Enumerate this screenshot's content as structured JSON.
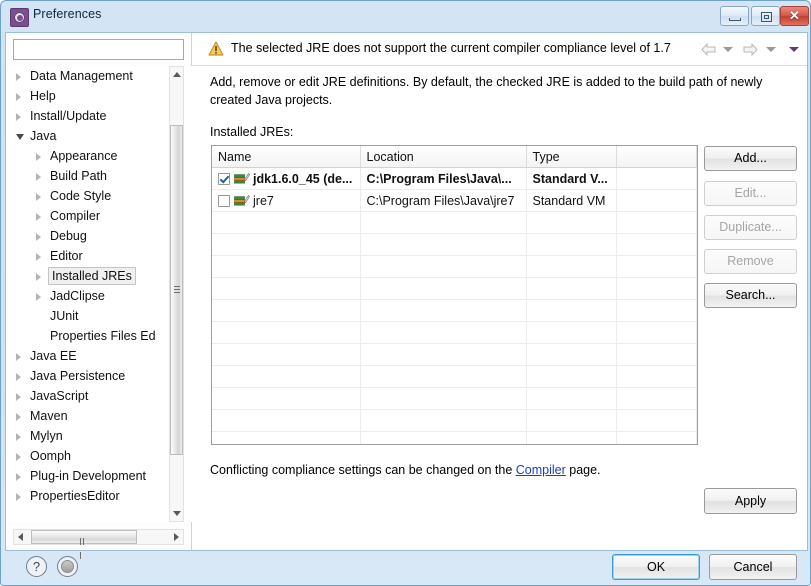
{
  "window": {
    "title": "Preferences",
    "icon": "preferences-gear-icon",
    "controls": {
      "minimize": "minimize-button",
      "maximize": "maximize-button",
      "close_glyph": "✕"
    }
  },
  "sidebar": {
    "filter_value": "",
    "filter_placeholder": "",
    "items": [
      {
        "label": "Data Management",
        "indent": 0,
        "state": "collapsed"
      },
      {
        "label": "Help",
        "indent": 0,
        "state": "collapsed"
      },
      {
        "label": "Install/Update",
        "indent": 0,
        "state": "collapsed"
      },
      {
        "label": "Java",
        "indent": 0,
        "state": "expanded"
      },
      {
        "label": "Appearance",
        "indent": 1,
        "state": "collapsed"
      },
      {
        "label": "Build Path",
        "indent": 1,
        "state": "collapsed"
      },
      {
        "label": "Code Style",
        "indent": 1,
        "state": "collapsed"
      },
      {
        "label": "Compiler",
        "indent": 1,
        "state": "collapsed"
      },
      {
        "label": "Debug",
        "indent": 1,
        "state": "collapsed"
      },
      {
        "label": "Editor",
        "indent": 1,
        "state": "collapsed"
      },
      {
        "label": "Installed JREs",
        "indent": 1,
        "state": "collapsed",
        "focused": true
      },
      {
        "label": "JadClipse",
        "indent": 1,
        "state": "collapsed"
      },
      {
        "label": "JUnit",
        "indent": 1,
        "state": "leaf"
      },
      {
        "label": "Properties Files Ed",
        "indent": 1,
        "state": "leaf"
      },
      {
        "label": "Java EE",
        "indent": 0,
        "state": "collapsed"
      },
      {
        "label": "Java Persistence",
        "indent": 0,
        "state": "collapsed"
      },
      {
        "label": "JavaScript",
        "indent": 0,
        "state": "collapsed"
      },
      {
        "label": "Maven",
        "indent": 0,
        "state": "collapsed"
      },
      {
        "label": "Mylyn",
        "indent": 0,
        "state": "collapsed"
      },
      {
        "label": "Oomph",
        "indent": 0,
        "state": "collapsed"
      },
      {
        "label": "Plug-in Development",
        "indent": 0,
        "state": "collapsed"
      },
      {
        "label": "PropertiesEditor",
        "indent": 0,
        "state": "collapsed"
      }
    ]
  },
  "message_bar": {
    "icon": "warning-icon",
    "text": "The selected JRE does not support the current compiler compliance level of 1.7",
    "nav": {
      "back": "back-arrow-icon",
      "back_menu": "back-dropdown-icon",
      "forward": "forward-arrow-icon",
      "forward_menu": "forward-dropdown-icon",
      "view_menu": "view-menu-icon"
    }
  },
  "page": {
    "description": "Add, remove or edit JRE definitions. By default, the checked JRE is added to the build path of newly created Java projects.",
    "table_label": "Installed JREs:",
    "table": {
      "columns": [
        "Name",
        "Location",
        "Type",
        ""
      ],
      "rows": [
        {
          "checked": true,
          "bold": true,
          "name": "jdk1.6.0_45 (de...",
          "location": "C:\\Program Files\\Java\\...",
          "type": "Standard V...",
          "extra": ""
        },
        {
          "checked": false,
          "bold": false,
          "name": "jre7",
          "location": "C:\\Program Files\\Java\\jre7",
          "type": "Standard VM",
          "extra": ""
        }
      ],
      "empty_row_count": 11
    },
    "buttons": [
      {
        "label": "Add...",
        "enabled": true
      },
      {
        "label": "Edit...",
        "enabled": false
      },
      {
        "label": "Duplicate...",
        "enabled": false
      },
      {
        "label": "Remove",
        "enabled": false
      },
      {
        "label": "Search...",
        "enabled": true
      }
    ],
    "conflict_prefix": "Conflicting compliance settings can be changed on the ",
    "conflict_link": "Compiler",
    "conflict_suffix": " page.",
    "apply_label": "Apply"
  },
  "footer": {
    "help_icon": "?",
    "ok_label": "OK",
    "cancel_label": "Cancel"
  },
  "colors": {
    "titlebar_blue": "#d3e4f4",
    "close_red": "#c0402f",
    "link_blue": "#1a3fbe",
    "warning_amber": "#f0b428",
    "ok_focus_blue": "#3c9ad6"
  }
}
